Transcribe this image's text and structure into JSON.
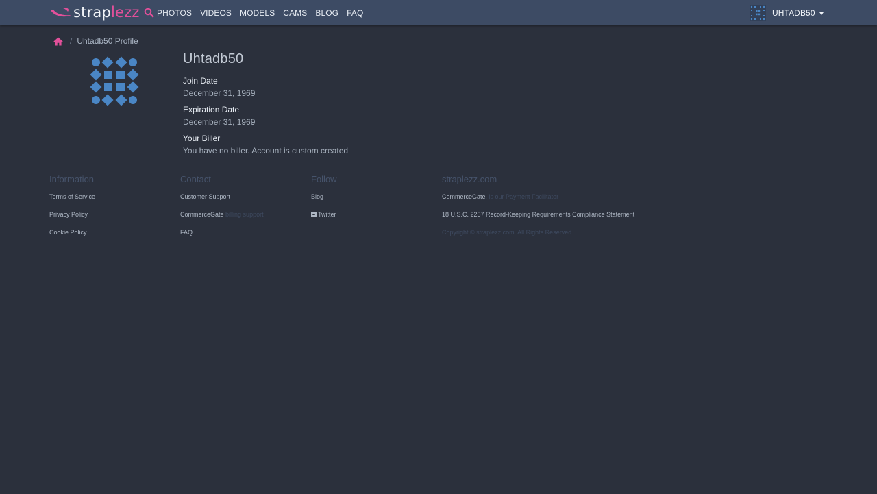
{
  "brand": {
    "logo_part1": "strap",
    "logo_part2": "lezz"
  },
  "nav": {
    "items": [
      {
        "label": "PHOTOS"
      },
      {
        "label": "VIDEOS"
      },
      {
        "label": "MODELS"
      },
      {
        "label": "CAMS"
      },
      {
        "label": "BLOG"
      },
      {
        "label": "FAQ"
      }
    ]
  },
  "user": {
    "name": "UHTADB50"
  },
  "breadcrumb": {
    "current": "Uhtadb50 Profile",
    "separator": "/"
  },
  "profile": {
    "username": "Uhtadb50",
    "join_date_label": "Join Date",
    "join_date": "December 31, 1969",
    "expiration_label": "Expiration Date",
    "expiration_date": "December 31, 1969",
    "biller_label": "Your Biller",
    "biller_value": "You have no biller. Account is custom created"
  },
  "footer": {
    "information": {
      "title": "Information",
      "items": [
        "Terms of Service",
        "Privacy Policy",
        "Cookie Policy"
      ]
    },
    "contact": {
      "title": "Contact",
      "support": "Customer Support",
      "billing_name": "CommerceGate",
      "billing_suffix": "billing support",
      "faq": "FAQ"
    },
    "follow": {
      "title": "Follow",
      "blog": "Blog",
      "twitter": "Twitter"
    },
    "site": {
      "title": "straplezz.com",
      "facilitator_name": "CommerceGate",
      "facilitator_suffix": ", is our Payment Facilitator",
      "compliance": "18 U.S.C. 2257 Record-Keeping Requirements Compliance Statement",
      "copyright": "Copyright © straplezz.com. All Rights Reserved."
    }
  },
  "colors": {
    "navbar_bg": "#3d4b64",
    "page_bg": "#2b303c",
    "accent_pink": "#e2509a",
    "avatar_blue": "#4a86c5"
  },
  "icons": {
    "search": "search-icon",
    "home": "home-icon",
    "caret": "caret-down-icon",
    "twitter": "twitter-icon"
  }
}
